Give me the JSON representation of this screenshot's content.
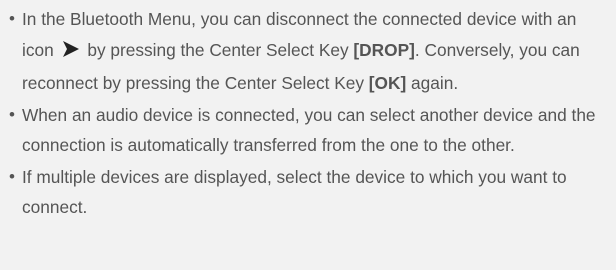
{
  "notes": [
    {
      "bullet": "•",
      "parts": {
        "t1": "In the Bluetooth Menu, you can disconnect the connected device with an icon",
        "icon": "right-arrowhead-icon",
        "t2": "by pressing the Center Select Key",
        "k1": "[DROP]",
        "t3": ". Conversely, you can reconnect by pressing the Center Select Key",
        "k2": "[OK]",
        "t4": "again."
      }
    },
    {
      "bullet": "•",
      "text": "When an audio device is connected, you can select another device and the connection is automatically transferred from the one to the other."
    },
    {
      "bullet": "•",
      "text": "If multiple devices are displayed, select the device to which you want to connect."
    }
  ],
  "colors": {
    "background": "#f2f2f2",
    "text": "#555555",
    "icon": "#222222"
  }
}
